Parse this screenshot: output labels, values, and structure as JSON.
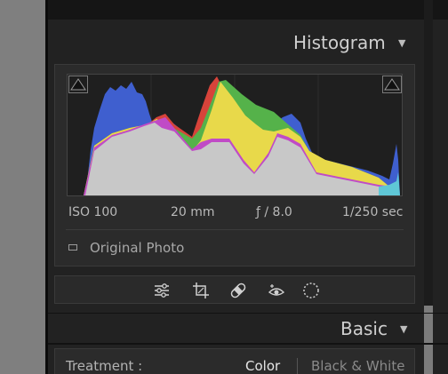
{
  "histogram_panel": {
    "title": "Histogram",
    "collapse_glyph": "▼",
    "iso": "ISO 100",
    "focal_length": "20 mm",
    "aperture": "ƒ / 8.0",
    "shutter": "1/250 sec",
    "original_photo_label": "Original Photo"
  },
  "tools": [
    {
      "name": "edit-sliders-icon"
    },
    {
      "name": "crop-icon"
    },
    {
      "name": "healing-bandage-icon"
    },
    {
      "name": "red-eye-icon"
    },
    {
      "name": "masking-icon"
    }
  ],
  "basic_panel": {
    "title": "Basic",
    "collapse_glyph": "▼",
    "treatment_label": "Treatment :",
    "treatment_options": [
      "Color",
      "Black & White"
    ],
    "treatment_selected": "Color"
  },
  "colors": {
    "panel_bg": "#222222",
    "histogram_gray": "#c8c8c8",
    "histogram_blue": "#3f5fcf",
    "histogram_yellow": "#e8d94a",
    "histogram_green": "#55b24a",
    "histogram_red": "#d7433a",
    "histogram_magenta": "#c04bc6",
    "histogram_cyan": "#5fc7d6"
  }
}
